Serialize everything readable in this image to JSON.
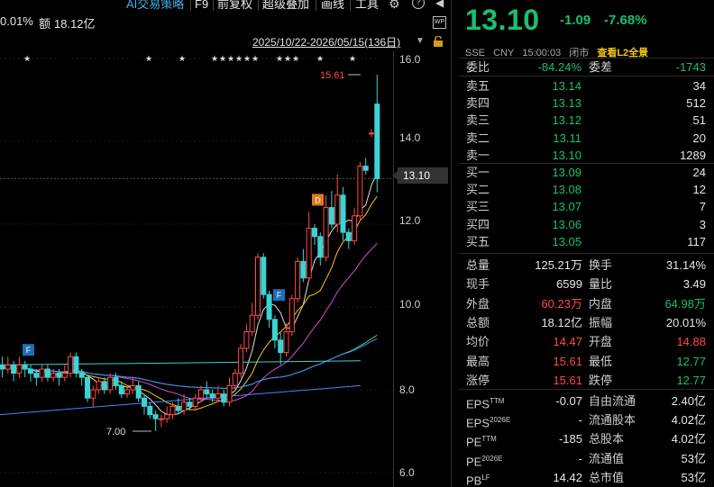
{
  "toolbar": {
    "pct_fragment": "0.01%",
    "amount_label": "额",
    "amount_value": "18.12亿",
    "ai_strategy": "AI交易策略",
    "f9": "F9",
    "adjust": "前复权",
    "overlay": "超级叠加",
    "draw": "画线",
    "tools": "工具",
    "wp_badge": "WP"
  },
  "chart_header": {
    "date_range": "2025/10/22-2026/05/15(136日)"
  },
  "chart": {
    "price_axis": [
      "16.0",
      "14.0",
      "12.0",
      "10.0",
      "8.0",
      "6.0"
    ],
    "current_price_tag": "13.10",
    "high_label": "15.61",
    "low_label": "7.00",
    "markers": [
      "F",
      "F",
      "D"
    ],
    "up_color": "#ff4a4a",
    "down_color": "#3ad4d4"
  },
  "chart_data": {
    "type": "candlestick",
    "ylim": [
      6,
      16
    ],
    "high_annotation": 15.61,
    "low_annotation": 7.0,
    "current_price": 13.1
  },
  "quote": {
    "last_price": "13.10",
    "change_abs": "-1.09",
    "change_pct": "-7.68%",
    "exchange": "SSE",
    "currency": "CNY",
    "time": "15:00:03",
    "status": "闭市",
    "l2_link": "查看L2全景",
    "wei_bi_label": "委比",
    "wei_bi": "-84.24%",
    "wei_cha_label": "委差",
    "wei_cha": "-1743",
    "asks": [
      {
        "label": "卖五",
        "price": "13.14",
        "vol": "34"
      },
      {
        "label": "卖四",
        "price": "13.13",
        "vol": "512"
      },
      {
        "label": "卖三",
        "price": "13.12",
        "vol": "51"
      },
      {
        "label": "卖二",
        "price": "13.11",
        "vol": "20"
      },
      {
        "label": "卖一",
        "price": "13.10",
        "vol": "1289"
      }
    ],
    "bids": [
      {
        "label": "买一",
        "price": "13.09",
        "vol": "24"
      },
      {
        "label": "买二",
        "price": "13.08",
        "vol": "12"
      },
      {
        "label": "买三",
        "price": "13.07",
        "vol": "7"
      },
      {
        "label": "买四",
        "price": "13.06",
        "vol": "3"
      },
      {
        "label": "买五",
        "price": "13.05",
        "vol": "117"
      }
    ],
    "stats": [
      {
        "l1": "总量",
        "v1": "125.21万",
        "c1": "white",
        "l2": "换手",
        "v2": "31.14%",
        "c2": "white"
      },
      {
        "l1": "现手",
        "v1": "6599",
        "c1": "white",
        "l2": "量比",
        "v2": "3.49",
        "c2": "white"
      },
      {
        "l1": "外盘",
        "v1": "60.23万",
        "c1": "red",
        "l2": "内盘",
        "v2": "64.98万",
        "c2": "green"
      },
      {
        "l1": "总额",
        "v1": "18.12亿",
        "c1": "white",
        "l2": "振幅",
        "v2": "20.01%",
        "c2": "white"
      },
      {
        "l1": "均价",
        "v1": "14.47",
        "c1": "red",
        "l2": "开盘",
        "v2": "14.88",
        "c2": "red"
      },
      {
        "l1": "最高",
        "v1": "15.61",
        "c1": "red",
        "l2": "最低",
        "v2": "12.77",
        "c2": "green"
      },
      {
        "l1": "涨停",
        "v1": "15.61",
        "c1": "red",
        "l2": "跌停",
        "v2": "12.77",
        "c2": "green"
      }
    ],
    "fundamentals": [
      {
        "l1": "EPS",
        "s1": "TTM",
        "v1": "-0.07",
        "l2": "自由流通",
        "v2": "2.40亿"
      },
      {
        "l1": "EPS",
        "s1": "2026E",
        "v1": "-",
        "l2": "流通股本",
        "v2": "4.02亿"
      },
      {
        "l1": "PE",
        "s1": "TTM",
        "v1": "-185",
        "l2": "总股本",
        "v2": "4.02亿"
      },
      {
        "l1": "PE",
        "s1": "2026E",
        "v1": "-",
        "l2": "流通值",
        "v2": "53亿"
      },
      {
        "l1": "PB",
        "s1": "LF",
        "v1": "14.42",
        "l2": "总市值",
        "v2": "53亿"
      }
    ]
  }
}
